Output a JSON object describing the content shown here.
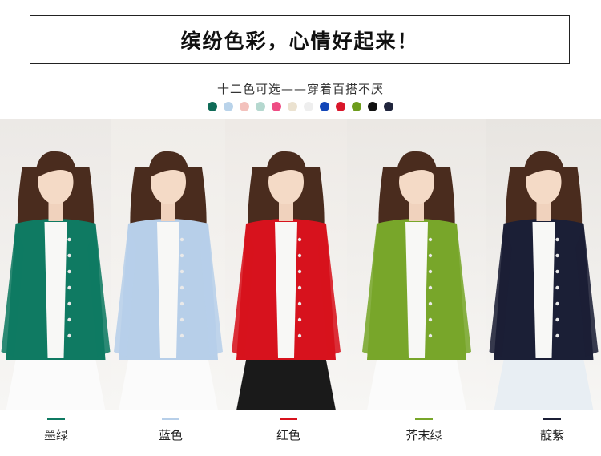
{
  "header": {
    "title": "缤纷色彩，心情好起来！"
  },
  "subtitle": "十二色可选——穿着百搭不厌",
  "swatch_colors": [
    "#0f6b57",
    "#b9d3ea",
    "#f3c1bc",
    "#b5d8cf",
    "#ee4c83",
    "#ebe2d0",
    "#eeeeee",
    "#1246b8",
    "#d9162a",
    "#6d9c1c",
    "#111111",
    "#20253c"
  ],
  "products": [
    {
      "name": "墨绿",
      "color": "#0f7a62",
      "bg": "#ece9e6"
    },
    {
      "name": "蓝色",
      "color": "#b7cfe9",
      "bg": "#f0ede9"
    },
    {
      "name": "红色",
      "color": "#d7121d",
      "bg": "#eeeae6"
    },
    {
      "name": "芥末绿",
      "color": "#78a62a",
      "bg": "#ebe8e4"
    },
    {
      "name": "靛紫",
      "color": "#1b1f36",
      "bg": "#e8e5e1"
    }
  ]
}
